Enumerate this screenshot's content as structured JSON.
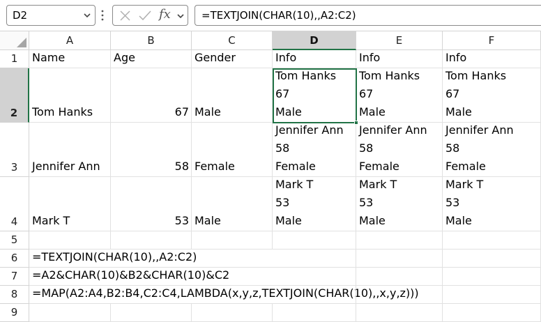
{
  "formula_bar": {
    "name_box": "D2",
    "fx_label": "fx",
    "formula": "=TEXTJOIN(CHAR(10),,A2:C2)"
  },
  "columns": [
    "A",
    "B",
    "C",
    "D",
    "E",
    "F"
  ],
  "selected_column": "D",
  "rows": [
    {
      "number": "1",
      "cells": [
        "Name",
        "Age",
        "Gender",
        "Info",
        "Info",
        "Info"
      ]
    },
    {
      "number": "2",
      "cells": [
        "Tom Hanks",
        "67",
        "Male",
        "Tom Hanks\n67\nMale",
        "Tom Hanks\n67\nMale",
        "Tom Hanks\n67\nMale"
      ]
    },
    {
      "number": "3",
      "cells": [
        "Jennifer Ann",
        "58",
        "Female",
        "Jennifer Ann\n58\nFemale",
        "Jennifer Ann\n58\nFemale",
        "Jennifer Ann\n58\nFemale"
      ]
    },
    {
      "number": "4",
      "cells": [
        "Mark T",
        "53",
        "Male",
        "Mark T\n53\nMale",
        "Mark T\n53\nMale",
        "Mark T\n53\nMale"
      ]
    },
    {
      "number": "5",
      "cells": [
        "",
        "",
        "",
        "",
        "",
        ""
      ]
    },
    {
      "number": "6",
      "cells": [
        "=TEXTJOIN(CHAR(10),,A2:C2)",
        "",
        "",
        "",
        "",
        ""
      ]
    },
    {
      "number": "7",
      "cells": [
        "=A2&CHAR(10)&B2&CHAR(10)&C2",
        "",
        "",
        "",
        "",
        ""
      ]
    },
    {
      "number": "8",
      "cells": [
        "=MAP(A2:A4,B2:B4,C2:C4,LAMBDA(x,y,z,TEXTJOIN(CHAR(10),,x,y,z)))",
        "",
        "",
        "",
        "",
        ""
      ]
    },
    {
      "number": "9",
      "cells": [
        "",
        "",
        "",
        "",
        "",
        ""
      ]
    }
  ],
  "selected_cell": "D2",
  "colors": {
    "accent": "#217346",
    "header_selected": "#d2d2d2",
    "gridline": "#e1e1e1"
  },
  "icons": {
    "name_box_dropdown": "chevron-down-icon",
    "more": "vertical-dots-icon",
    "cancel": "cancel-x-icon",
    "enter": "check-icon",
    "formula_dropdown": "chevron-down-icon"
  }
}
